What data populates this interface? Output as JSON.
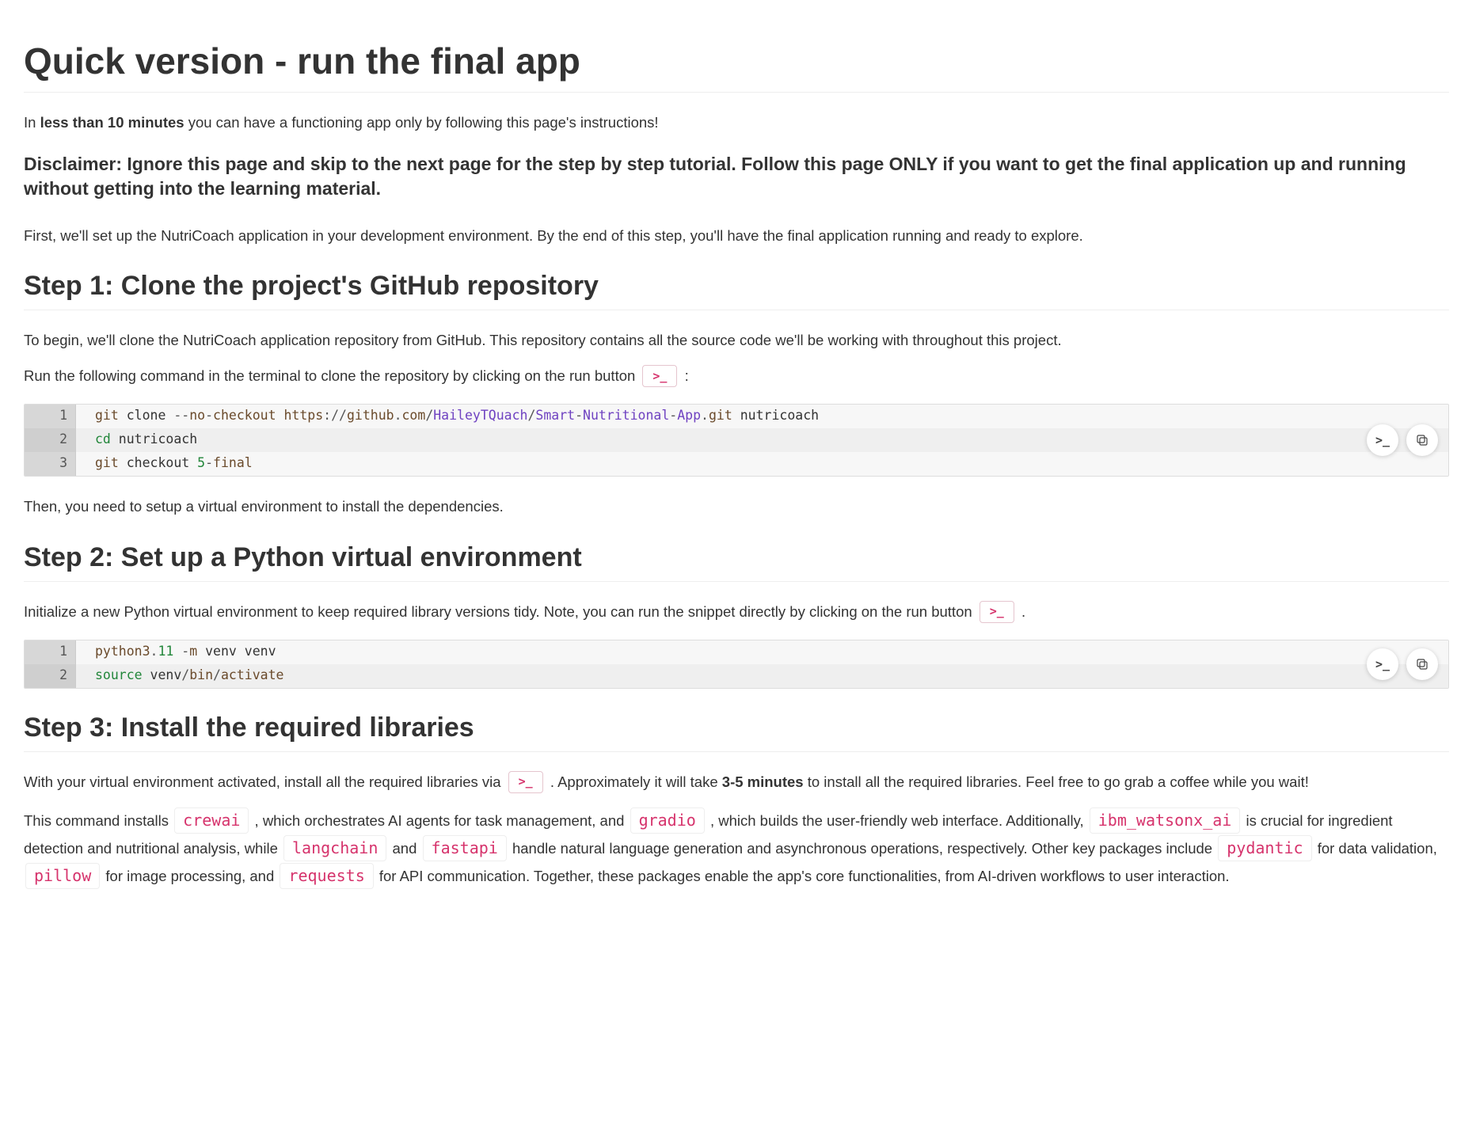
{
  "title": "Quick version - run the final app",
  "intro": {
    "pre": "In ",
    "bold": "less than 10 minutes",
    "post": " you can have a functioning app only by following this page's instructions!"
  },
  "disclaimer": "Disclaimer: Ignore this page and skip to the next page for the step by step tutorial. Follow this page ONLY if you want to get the final application up and running without getting into the learning material.",
  "first_para": "First, we'll set up the NutriCoach application in your development environment. By the end of this step, you'll have the final application running and ready to explore.",
  "step1": {
    "heading": "Step 1: Clone the project's GitHub repository",
    "p1": "To begin, we'll clone the NutriCoach application repository from GitHub. This repository contains all the source code we'll be working with throughout this project.",
    "p2_pre": "Run the following command in the terminal to clone the repository by clicking on the run button ",
    "p2_post": " :",
    "after": "Then, you need to setup a virtual environment to install the dependencies.",
    "code": [
      "git clone --no-checkout https://github.com/HaileyTQuach/Smart-Nutritional-App.git nutricoach",
      "cd nutricoach",
      "git checkout 5-final"
    ],
    "tokens": {
      "l1": {
        "w0": "git",
        "w1": " clone ",
        "w2": "--",
        "w3": "no",
        "w4": "-",
        "w5": "checkout",
        "w6": " https",
        "w7": ":",
        "w8": "//",
        "w9": "github",
        "w10": ".",
        "w11": "com",
        "w12": "/",
        "w13": "HaileyTQuach",
        "w14": "/",
        "w15": "Smart",
        "w16": "-",
        "w17": "Nutritional",
        "w18": "-",
        "w19": "App",
        "w20": ".",
        "w21": "git",
        "w22": " nutricoach"
      },
      "l2": {
        "w0": "cd",
        "w1": " nutricoach"
      },
      "l3": {
        "w0": "git",
        "w1": " checkout ",
        "w2": "5",
        "w3": "-",
        "w4": "final"
      }
    }
  },
  "step2": {
    "heading": "Step 2: Set up a Python virtual environment",
    "p1_pre": "Initialize a new Python virtual environment to keep required library versions tidy. Note, you can run the snippet directly by clicking on the run button ",
    "p1_post": " .",
    "code": [
      "python3.11 -m venv venv",
      "source venv/bin/activate"
    ],
    "tokens": {
      "l1": {
        "w0": "python3",
        "w1": ".",
        "w2": "11",
        "w3": " ",
        "w4": "-",
        "w5": "m",
        "w6": " venv venv"
      },
      "l2": {
        "w0": "source",
        "w1": " venv",
        "w2": "/",
        "w3": "bin",
        "w4": "/",
        "w5": "activate"
      }
    }
  },
  "step3": {
    "heading": "Step 3: Install the required libraries",
    "p1_pre": "With your virtual environment activated, install all the required libraries via ",
    "p1_mid": " . Approximately it will take ",
    "p1_bold": "3-5 minutes",
    "p1_post": " to install all the required libraries. Feel free to go grab a coffee while you wait!",
    "p2": {
      "t0": "This command installs ",
      "c0": "crewai",
      "t1": " , which orchestrates AI agents for task management, and ",
      "c1": "gradio",
      "t2": " , which builds the user-friendly web interface. Additionally, ",
      "c2": "ibm_watsonx_ai",
      "t3": " is crucial for ingredient detection and nutritional analysis, while ",
      "c3": "langchain",
      "t4": " and ",
      "c4": "fastapi",
      "t5": " handle natural language generation and asynchronous operations, respectively. Other key packages include ",
      "c5": "pydantic",
      "t6": " for data validation, ",
      "c6": "pillow",
      "t7": " for image processing, and ",
      "c7": "requests",
      "t8": " for API communication. Together, these packages enable the app's core functionalities, from AI-driven workflows to user interaction."
    }
  }
}
